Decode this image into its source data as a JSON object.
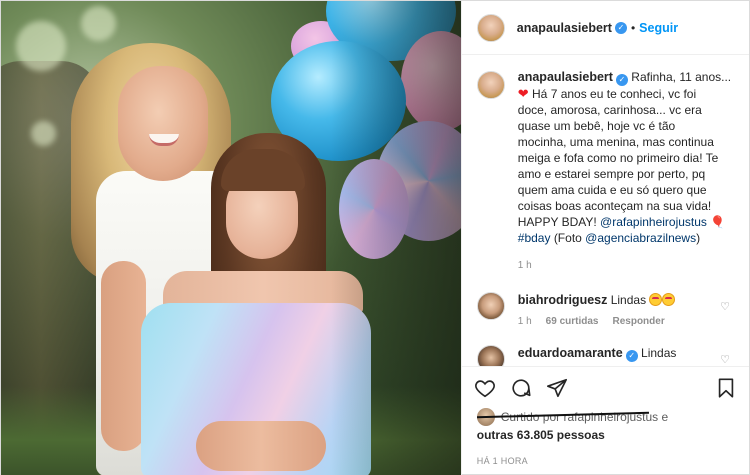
{
  "header": {
    "username": "anapaulasiebert",
    "follow_label": "Seguir",
    "dot": "•",
    "verified_icon": "verified-badge-icon"
  },
  "caption": {
    "username": "anapaulasiebert",
    "text_lines": [
      "Rafinha, 11 anos...",
      "Há 7 anos eu te conheci, vc foi",
      "doce, amorosa, carinhosa... vc era",
      "quase um bebê, hoje vc é tão",
      "mocinha, uma menina, mas continua",
      "meiga e fofa como no primeiro dia! Te",
      "amo e estarei sempre por perto, pq",
      "quem ama cuida e eu só quero que",
      "coisas boas aconteçam na sua vida!",
      "HAPPY BDAY!"
    ],
    "mention_1": "@rafapinheirojustus",
    "hashtag": "#bday",
    "foto_prefix": "(Foto",
    "mention_2": "@agenciabrazilnews",
    "foto_suffix": ")",
    "time": "1 h"
  },
  "comments": [
    {
      "username": "biahrodriguesz",
      "text": "Lindas",
      "time": "1 h",
      "likes": "69 curtidas",
      "reply": "Responder"
    },
    {
      "username": "eduardoamarante",
      "text": "Lindas"
    }
  ],
  "likes": {
    "obscured_text": "Curtido por rafapinheirojustus e",
    "others": "outras 63.805 pessoas"
  },
  "timestamp": "HÁ 1 HORA",
  "icons": {
    "like": "heart-icon",
    "comment": "comment-icon",
    "share": "share-icon",
    "save": "bookmark-icon"
  },
  "colors": {
    "accent": "#0095f6",
    "verified": "#3897f0",
    "mention": "#00376b",
    "muted": "#8e8e8e"
  }
}
